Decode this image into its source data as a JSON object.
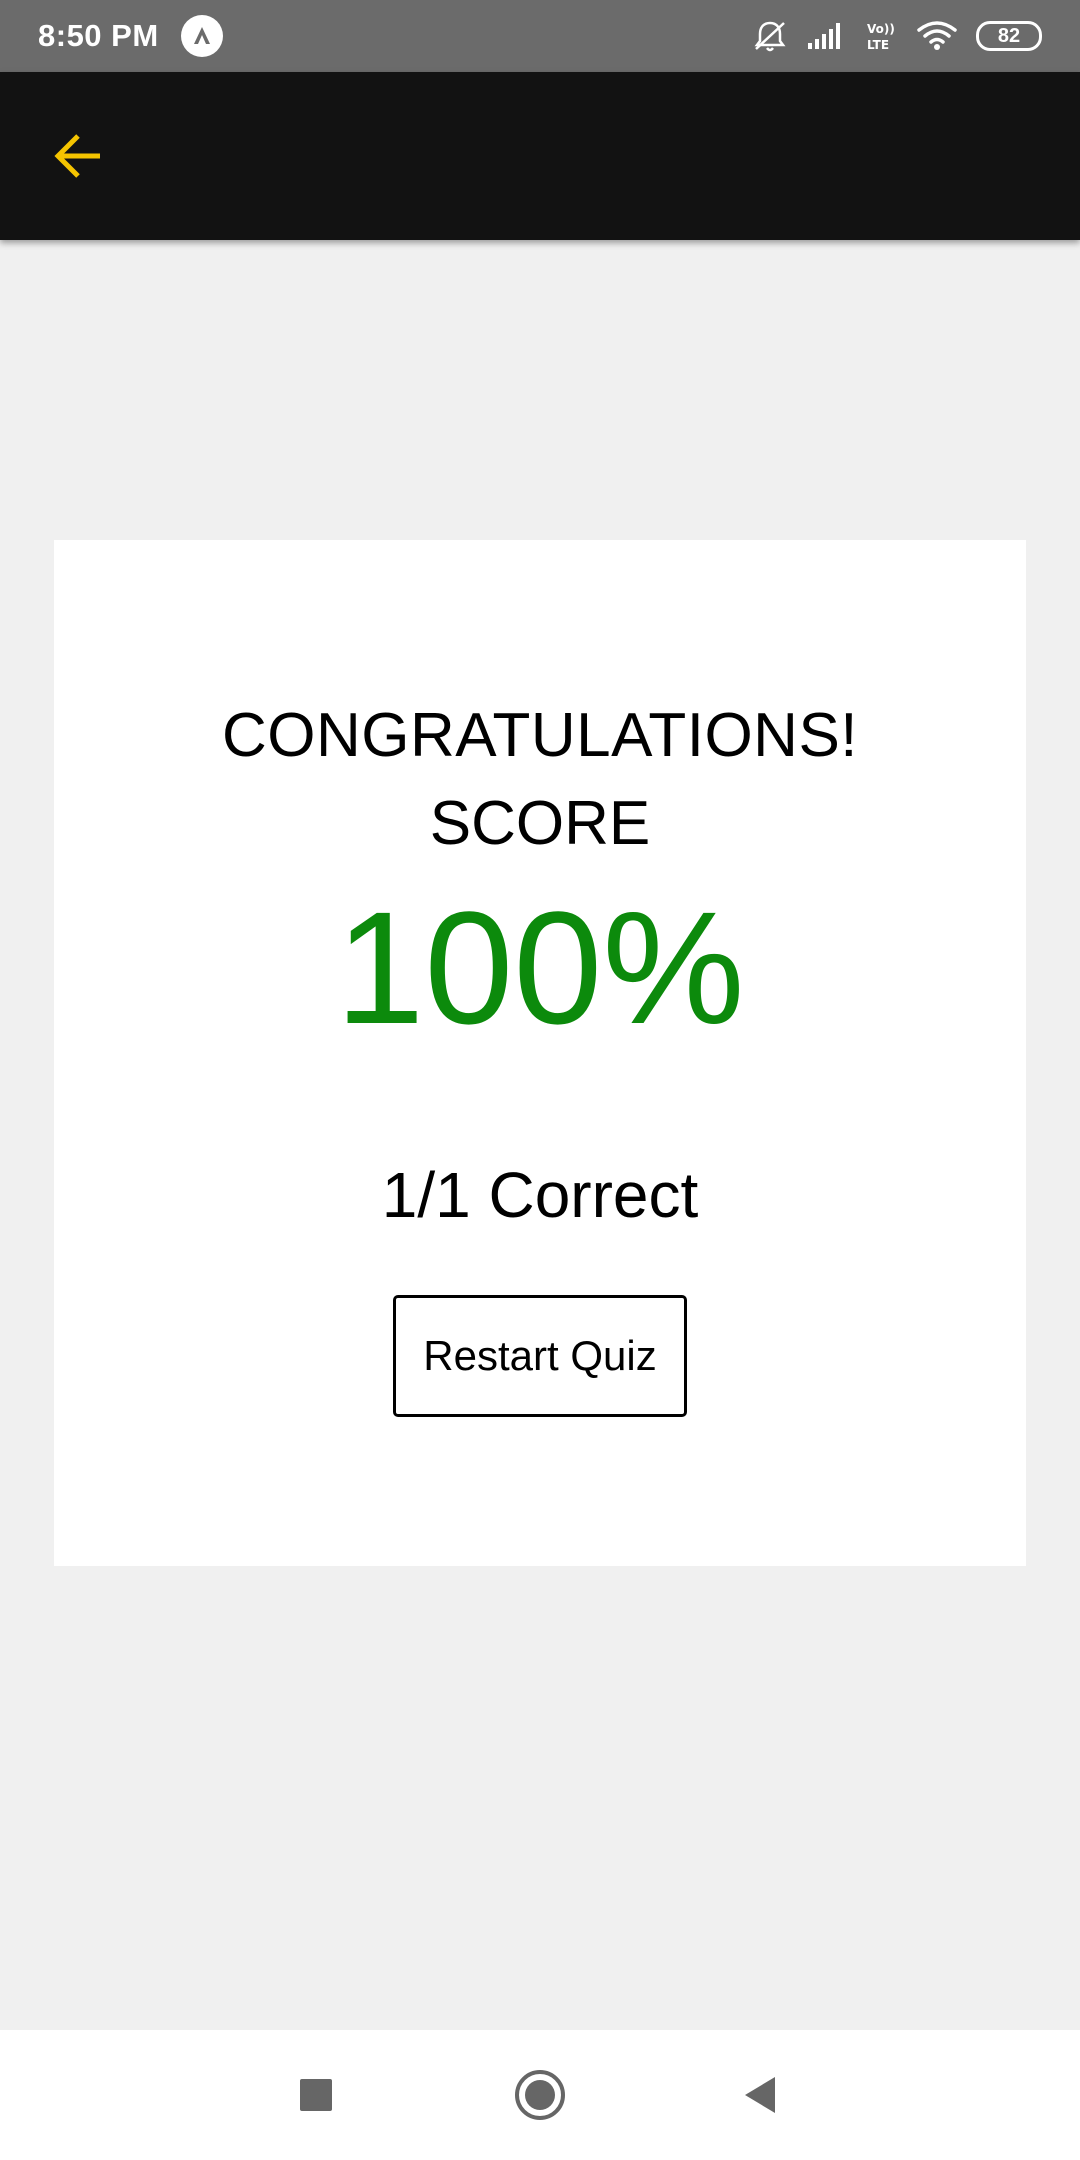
{
  "status_bar": {
    "time": "8:50 PM",
    "battery": "82",
    "icons": [
      "app-notification-icon",
      "mute-icon",
      "signal-icon",
      "volte-icon",
      "wifi-icon",
      "battery-icon"
    ]
  },
  "app_bar": {
    "back_icon": "arrow-left-icon",
    "accent_color": "#f5c400"
  },
  "result": {
    "heading": "CONGRATULATIONS!",
    "score_label": "SCORE",
    "score_value": "100%",
    "score_color": "#0c8a0c",
    "correct_text": "1/1 Correct",
    "restart_label": "Restart Quiz"
  },
  "nav_bar": {
    "icons": [
      "recents-square-icon",
      "home-circle-icon",
      "back-triangle-icon"
    ]
  }
}
